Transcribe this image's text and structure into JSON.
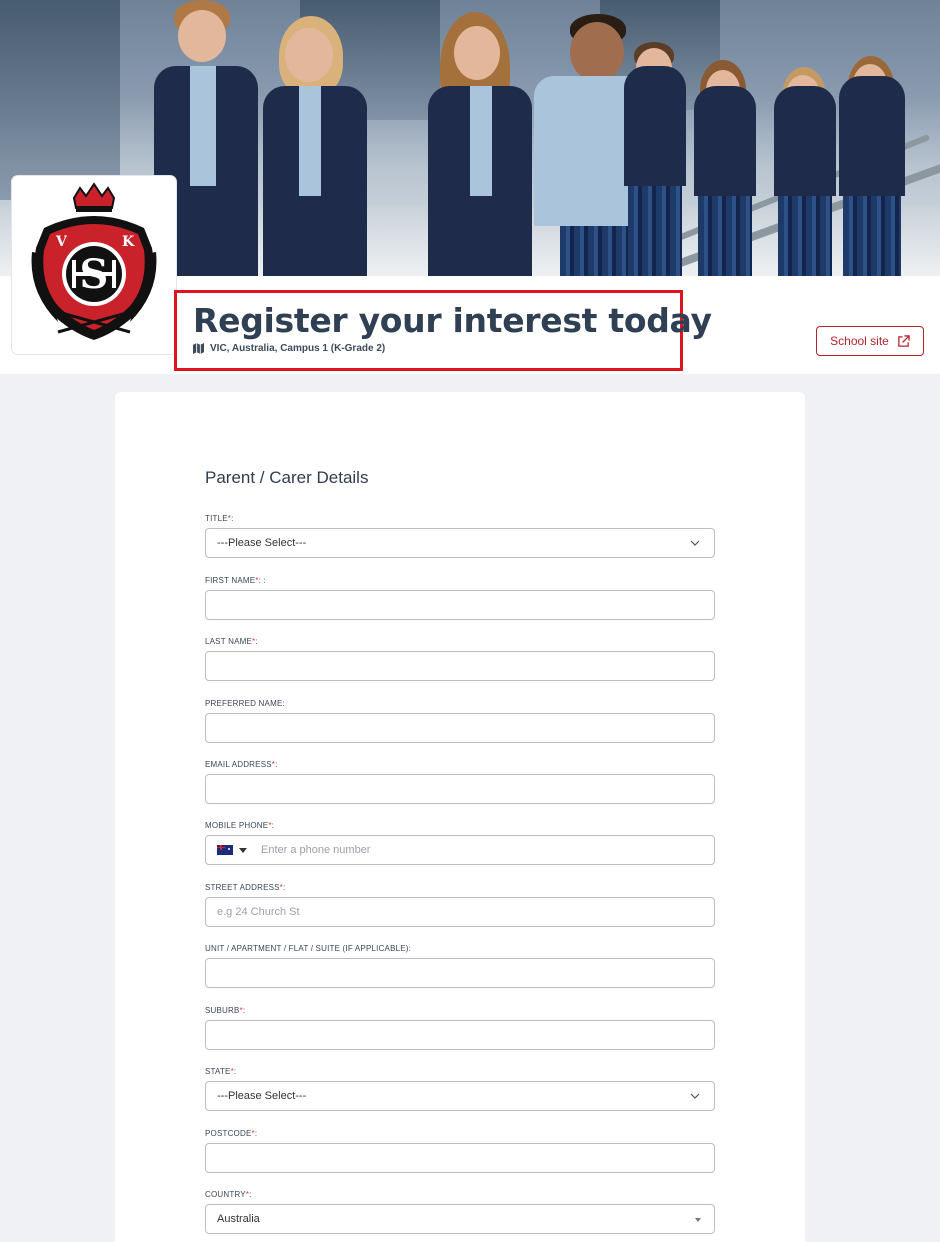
{
  "header": {
    "title": "Register your interest today",
    "location": "VIC, Australia, Campus 1 (K-Grade 2)",
    "school_site_label": "School site"
  },
  "logo": {
    "letters": "VSHK"
  },
  "form": {
    "section_title": "Parent / Carer Details",
    "fields": [
      {
        "label": "TITLE",
        "suffix": ":",
        "required": true,
        "value": "---Please Select---"
      },
      {
        "label": "FIRST NAME",
        "suffix": ": :",
        "required": true
      },
      {
        "label": "LAST NAME",
        "suffix": ":",
        "required": true
      },
      {
        "label": "PREFERRED NAME:",
        "required": false
      },
      {
        "label": "EMAIL ADDRESS",
        "suffix": ":",
        "required": true
      },
      {
        "label": "MOBILE PHONE",
        "suffix": ":",
        "required": true,
        "placeholder": "Enter a phone number"
      },
      {
        "label": "STREET ADDRESS",
        "suffix": ":",
        "required": true,
        "placeholder": "e.g 24 Church St"
      },
      {
        "label": "UNIT / APARTMENT / FLAT / SUITE (IF APPLICABLE):",
        "required": false
      },
      {
        "label": "SUBURB",
        "suffix": ":",
        "required": true
      },
      {
        "label": "STATE",
        "suffix": ":",
        "required": true,
        "value": "---Please Select---"
      },
      {
        "label": "POSTCODE",
        "suffix": ":",
        "required": true
      },
      {
        "label": "COUNTRY",
        "suffix": ":",
        "required": true,
        "value": "Australia"
      }
    ],
    "required_mark": "*"
  },
  "colors": {
    "accent": "#b1252c",
    "highlight": "#e0141e",
    "title": "#2f4054",
    "background": "#f0f1f5"
  },
  "icons": {
    "location": "map-icon",
    "external": "external-link-icon",
    "select": "chevron-down-icon"
  }
}
